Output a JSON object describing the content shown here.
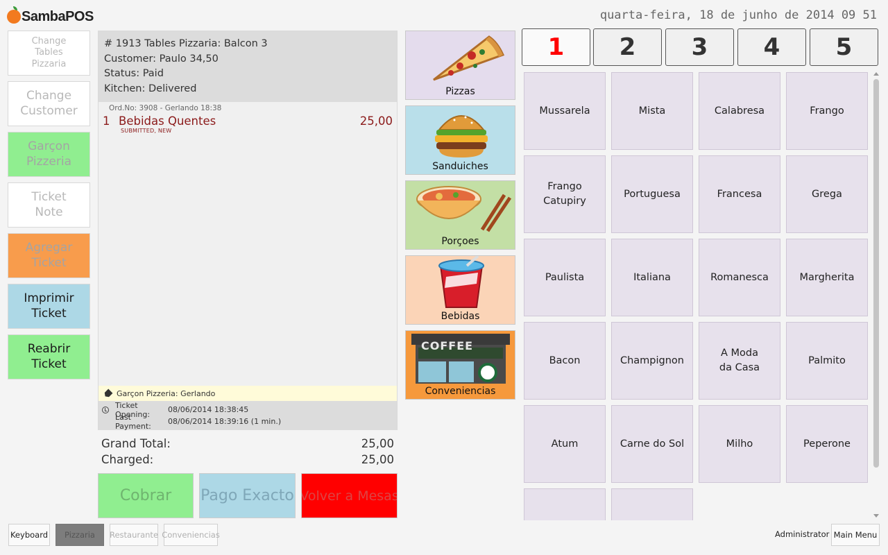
{
  "app": {
    "logo_text": "SambaPOS",
    "datetime": "quarta-feira, 18 de junho de 2014 09 51"
  },
  "left_buttons": [
    {
      "label": "Change Tables Pizzaria"
    },
    {
      "label": "Change Customer"
    },
    {
      "label": "Garçon Pizzeria"
    },
    {
      "label": "Ticket Note"
    },
    {
      "label": "Agregar Ticket"
    },
    {
      "label": "Imprimir Ticket"
    },
    {
      "label": "Reabrir Ticket"
    }
  ],
  "ticket": {
    "header_lines": [
      "# 1913 Tables Pizzaria: Balcon 3",
      "Customer: Paulo 34,50",
      "Status: Paid",
      "Kitchen: Delivered"
    ],
    "order_meta": "Ord.No: 3908 - Gerlando  18:38",
    "orders": [
      {
        "qty": "1",
        "name": "Bebidas Quentes",
        "price": "25,00",
        "state": "SUBMITTED, NEW"
      }
    ],
    "tag": "Garçon Pizzeria: Gerlando",
    "opening_label": "Ticket Opening:",
    "opening_value": "08/06/2014 18:38:45",
    "last_payment_label": "Last Payment:",
    "last_payment_value": "08/06/2014 18:39:16 (1 min.)"
  },
  "totals": {
    "grand_total_label": "Grand Total:",
    "grand_total_value": "25,00",
    "charged_label": "Charged:",
    "charged_value": "25,00"
  },
  "actions": {
    "cobrar": "Cobrar",
    "pago_exacto": "Pago Exacto",
    "volver": "Volver a Mesas"
  },
  "categories": [
    {
      "label": "Pizzas",
      "color": "#e4dced"
    },
    {
      "label": "Sanduiches",
      "color": "#b9dfea"
    },
    {
      "label": "Porçoes",
      "color": "#c3dfa5"
    },
    {
      "label": "Bebidas",
      "color": "#fbd4b7"
    },
    {
      "label": "Conveniencias",
      "color": "#f6993c"
    }
  ],
  "coffee_sign": "COFFEE",
  "number_tabs": [
    "1",
    "2",
    "3",
    "4",
    "5"
  ],
  "menu_items": [
    "Mussarela",
    "Mista",
    "Calabresa",
    "Frango",
    "Frango Catupiry",
    "Portuguesa",
    "Francesa",
    "Grega",
    "Paulista",
    "Italiana",
    "Romanesca",
    "Margherita",
    "Bacon",
    "Champignon",
    "A Moda da Casa",
    "Palmito",
    "Atum",
    "Carne do Sol",
    "Milho",
    "Peperone",
    "",
    ""
  ],
  "footer": {
    "keyboard": "Keyboard",
    "departments": [
      "Pizzaria",
      "Restaurante",
      "Conveniencias"
    ],
    "user": "Administrator",
    "main_menu": "Main Menu"
  }
}
